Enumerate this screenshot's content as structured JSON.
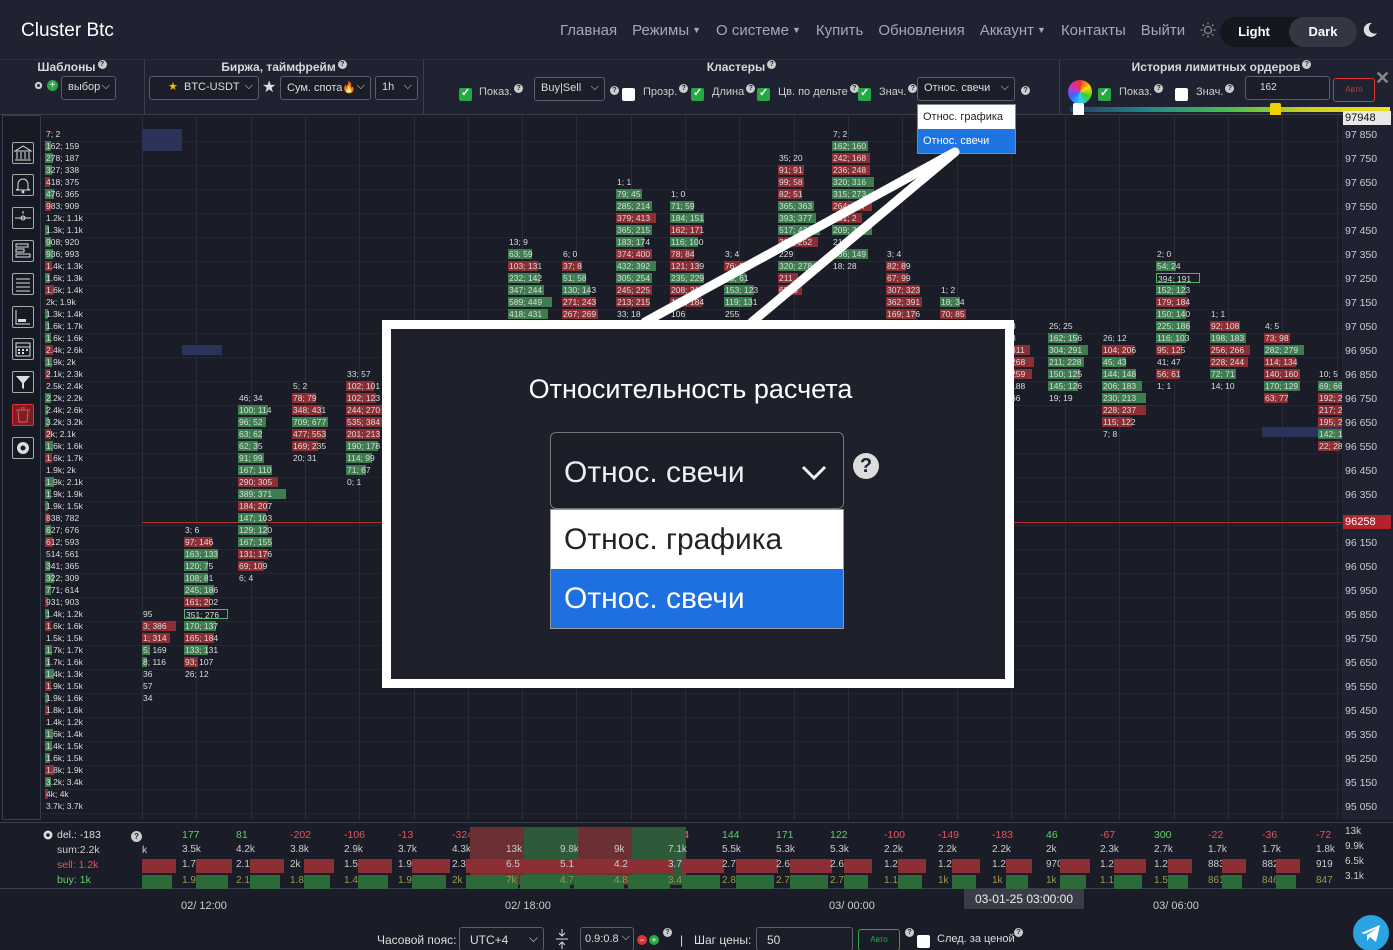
{
  "navbar": {
    "brand": "Cluster Btc",
    "items": [
      {
        "label": "Главная",
        "caret": false
      },
      {
        "label": "Режимы",
        "caret": true
      },
      {
        "label": "О системе",
        "caret": true
      },
      {
        "label": "Купить",
        "caret": false
      },
      {
        "label": "Обновления",
        "caret": false
      },
      {
        "label": "Аккаунт",
        "caret": true
      },
      {
        "label": "Контакты",
        "caret": false
      },
      {
        "label": "Выйти",
        "caret": false
      }
    ],
    "theme_light": "Light",
    "theme_dark": "Dark"
  },
  "toolbar": {
    "templates": {
      "title": "Шаблоны",
      "select": "выбор"
    },
    "exchange": {
      "title": "Биржа, таймфрейм",
      "pair": "BTC-USDT",
      "mode": "Сум. спота🔥",
      "timeframe": "1h"
    },
    "clusters": {
      "title": "Кластеры",
      "show": "Показ.",
      "type_select": "Buy|Sell",
      "transparency": "Прозр.",
      "length": "Длина",
      "color_by_delta": "Цв. по дельте",
      "value": "Знач.",
      "relativity_select": "Относ. свечи",
      "options": [
        "Относ. графика",
        "Относ. свечи"
      ]
    },
    "limit_history": {
      "title": "История лимитных ордеров",
      "show": "Показ.",
      "value": "Знач.",
      "input_value": "162",
      "auto": "Авто"
    }
  },
  "callout": {
    "title": "Относительность расчета",
    "selected": "Относ. свечи",
    "options": [
      "Относ. графика",
      "Относ. свечи"
    ]
  },
  "price_axis": {
    "top_badge": "97948",
    "current_badge": "96258",
    "labels": [
      "97 850",
      "97 750",
      "97 650",
      "97 550",
      "97 450",
      "97 350",
      "97 250",
      "97 150",
      "97 050",
      "96 950",
      "96 850",
      "96 750",
      "96 650",
      "96 550",
      "96 450",
      "96 350",
      "96 150",
      "96 050",
      "95 950",
      "95 850",
      "95 750",
      "95 650",
      "95 550",
      "95 450",
      "95 350",
      "95 250",
      "95 150",
      "95 050"
    ]
  },
  "clusters": {
    "profile": [
      "7; 2",
      "162; 159",
      "278; 187",
      "327; 338",
      "418; 375",
      "476; 365",
      "983; 909",
      "1.2k; 1.1k",
      "1.3k; 1.1k",
      "908; 920",
      "936; 993",
      "1.4k; 1.3k",
      "1.6k; 1.3k",
      "1.6k; 1.4k",
      "2k; 1.9k",
      "1.3k; 1.4k",
      "1.6k; 1.7k",
      "1.6k; 1.6k",
      "2.4k; 2.6k",
      "1.9k; 2k",
      "2.1k; 2.3k",
      "2.5k; 2.4k",
      "2.2k; 2.2k",
      "2.4k; 2.6k",
      "3.2k; 3.2k",
      "2k; 2.1k",
      "1.6k; 1.6k",
      "1.6k; 1.7k",
      "1.9k; 2k",
      "1.9k; 2.1k",
      "1.9k; 1.9k",
      "1.9k; 1.5k",
      "838; 782",
      "627; 676",
      "612; 593",
      "514; 561",
      "341; 365",
      "322; 309",
      "771; 614",
      "931; 903",
      "1.4k; 1.2k",
      "1.6k; 1.6k",
      "1.5k; 1.5k",
      "1.7k; 1.7k",
      "1.7k; 1.6k",
      "1.4k; 1.3k",
      "1.9k; 1.5k",
      "1.9k; 1.6k",
      "1.8k; 1.6k",
      "1.4k; 1.2k",
      "1.6k; 1.4k",
      "1.4k; 1.5k",
      "1.6k; 1.5k",
      "1.8k; 1.9k",
      "3.2k; 3.4k",
      "4k; 4k",
      "3.7k; 3.7k"
    ],
    "c1": [
      "95",
      "3; 386",
      "1; 314",
      "5; 169",
      "8; 116",
      "36",
      "57",
      "34"
    ],
    "c2": [
      "3; 6",
      "97; 146",
      "163; 133",
      "120; 75",
      "108; 81",
      "245; 186",
      "161; 202",
      "351; 276",
      "170; 137",
      "165; 184",
      "133; 131",
      "93; 107",
      "26; 12"
    ],
    "c3": [
      "46; 34",
      "100; 114",
      "96; 52",
      "63; 62",
      "62; 35",
      "91; 99",
      "167; 110",
      "290; 305",
      "389; 371",
      "184; 207",
      "147; 103",
      "129; 120",
      "167; 155",
      "131; 176",
      "69; 109",
      "6; 4"
    ],
    "c4": [
      "5; 2",
      "78; 79",
      "348; 431",
      "709; 677",
      "477; 553",
      "169; 235",
      "20; 31"
    ],
    "c5": [
      "33; 57",
      "102; 101",
      "102; 123",
      "244; 270",
      "535; 384",
      "201; 213",
      "190; 178",
      "114; 99",
      "71; 67",
      "0; 1"
    ],
    "c6": [
      "13; 9",
      "63; 59",
      "103; 131",
      "232; 142",
      "347; 244",
      "589; 449",
      "418; 431"
    ],
    "c7": [
      "6; 0",
      "37; 8",
      "51; 58",
      "130; 143",
      "271; 243",
      "267; 269"
    ],
    "c8": [
      "1; 1",
      "79; 45",
      "285; 214",
      "379; 413",
      "365; 215",
      "183; 174",
      "374; 400",
      "432; 392",
      "305; 254",
      "245; 225",
      "213; 215",
      "33; 18"
    ],
    "c9": [
      "1; 0",
      "71; 59",
      "184; 151",
      "162; 171",
      "116; 100",
      "78; 84",
      "121; 139",
      "235; 229",
      "208; 210",
      "183; 184",
      "106",
      "69; 102"
    ],
    "c10": [
      "3; 4",
      "76; 81",
      "65; 61",
      "153; 123",
      "119; 131",
      "255"
    ],
    "c11": [
      "35; 20",
      "91; 91",
      "99; 58",
      "82; 51",
      "365; 363",
      "393; 377",
      "517; 431",
      "302; 252",
      "229",
      "320; 278",
      "211",
      "65; 9"
    ],
    "c12": [
      "7; 2",
      "162; 160",
      "242; 168",
      "236; 248",
      "320; 316",
      "315; 273",
      "264; 257",
      "131; 2",
      "209; 236",
      "211",
      "166; 149",
      "18; 28"
    ],
    "c13": [
      "3; 4",
      "82; 89",
      "67; 99",
      "307; 323",
      "362; 391",
      "169; 176"
    ],
    "c14": [
      "1; 2",
      "18; 34",
      "70; 85"
    ],
    "c15": [
      "25; 25",
      "162; 156",
      "304; 291",
      "211; 228",
      "150; 125",
      "145; 126",
      "19; 19"
    ],
    "c16": [
      "26; 12",
      "104; 206",
      "45; 43",
      "144; 148",
      "206; 183",
      "230; 213",
      "228; 237",
      "115; 122",
      "7; 8"
    ],
    "c17": [
      "2; 0",
      "54; 24",
      "394; 191",
      "152; 123",
      "179; 184",
      "150; 140",
      "225; 186",
      "116; 103",
      "95; 125",
      "41; 47",
      "56; 61",
      "1; 1"
    ],
    "c18": [
      "1; 1",
      "92; 108",
      "198; 183",
      "256; 266",
      "228; 244",
      "72; 71",
      "14; 10"
    ],
    "c19": [
      "4; 5",
      "73; 98",
      "282; 279",
      "114; 134",
      "140; 160",
      "170; 129",
      "63; 77"
    ],
    "c20": [
      "10; 5",
      "69; 66",
      "192; 2",
      "217; 2",
      "195; 2",
      "142; 1",
      "22; 28"
    ],
    "partial_left": [
      "8",
      "3",
      "311",
      "268",
      "259",
      "188",
      "66"
    ]
  },
  "delta_panel": {
    "delta_label": "del.: -183",
    "sum_label": "sum:2.2k",
    "sell_label": "sell: 1.2k",
    "buy_label": "buy: 1k",
    "columns": [
      {
        "d": "177",
        "s": "3.5k",
        "b": "1.7k",
        "v": "1.9k"
      },
      {
        "d": "81",
        "s": "4.2k",
        "b": "2.1k",
        "v": "2.1k"
      },
      {
        "d": "-202",
        "s": "3.8k",
        "b": "2k",
        "v": "1.8k"
      },
      {
        "d": "-106",
        "s": "2.9k",
        "b": "1.5k",
        "v": "1.4k"
      },
      {
        "d": "-13",
        "s": "3.7k",
        "b": "1.9k",
        "v": "1.9k"
      },
      {
        "d": "-324",
        "s": "4.3k",
        "b": "2.3k",
        "v": "2k"
      },
      {
        "d": "492",
        "s": "13k",
        "b": "6.5k",
        "v": "7k"
      },
      {
        "d": "-460",
        "s": "9.8k",
        "b": "5.1k",
        "v": "4.7k"
      },
      {
        "d": "583",
        "s": "9k",
        "b": "4.2k",
        "v": "4.8k"
      },
      {
        "d": "-324",
        "s": "7.1k",
        "b": "3.7k",
        "v": "3.4k"
      },
      {
        "d": "144",
        "s": "5.5k",
        "b": "2.7k",
        "v": "2.8k"
      },
      {
        "d": "171",
        "s": "5.3k",
        "b": "2.6k",
        "v": "2.7k"
      },
      {
        "d": "122",
        "s": "5.3k",
        "b": "2.6k",
        "v": "2.7k"
      },
      {
        "d": "-100",
        "s": "2.2k",
        "b": "1.2k",
        "v": "1.1k"
      },
      {
        "d": "-149",
        "s": "2.2k",
        "b": "1.2k",
        "v": "1k"
      },
      {
        "d": "-183",
        "s": "2.2k",
        "b": "1.2k",
        "v": "1k"
      },
      {
        "d": "46",
        "s": "2k",
        "b": "970",
        "v": "1k"
      },
      {
        "d": "-67",
        "s": "2.3k",
        "b": "1.2k",
        "v": "1.1k"
      },
      {
        "d": "300",
        "s": "2.7k",
        "b": "1.2k",
        "v": "1.5k"
      },
      {
        "d": "-22",
        "s": "1.7k",
        "b": "883",
        "v": "861"
      },
      {
        "d": "-36",
        "s": "1.7k",
        "b": "882",
        "v": "846"
      },
      {
        "d": "-72",
        "s": "1.8k",
        "b": "919",
        "v": "847"
      }
    ],
    "axis": [
      "13k",
      "9.9k",
      "6.5k",
      "3.1k"
    ],
    "left_k": "k"
  },
  "time_axis": {
    "labels": [
      "02/ 12:00",
      "02/ 18:00",
      "03/ 00:00",
      "03/ 06:00"
    ],
    "badge": "03-01-25 03:00:00"
  },
  "bottom_bar": {
    "timezone_label": "Часовой пояс:",
    "timezone_value": "UTC+4",
    "ratio_value": "0.9:0.8",
    "sep": "|",
    "price_step_label": "Шаг цены:",
    "price_step_value": "50",
    "auto": "Авто",
    "follow_price": "След. за ценой"
  },
  "colors": {
    "buy": "#3e7d4f",
    "sell": "#8c2f35",
    "accent": "#1e6fe0",
    "current_price": "#b5222a"
  }
}
